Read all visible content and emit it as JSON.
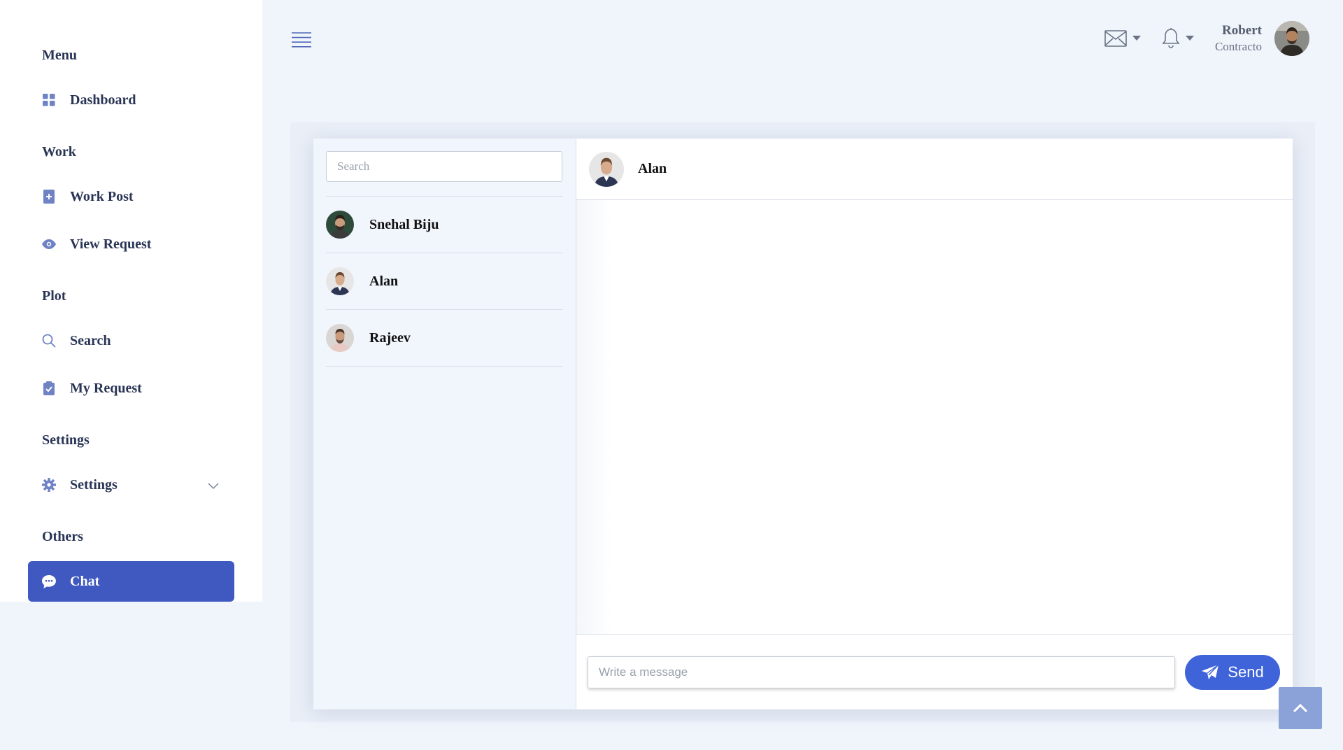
{
  "sidebar": {
    "sections": [
      {
        "heading": "Menu",
        "items": [
          {
            "label": "Dashboard",
            "icon": "dashboard-icon"
          }
        ]
      },
      {
        "heading": "Work",
        "items": [
          {
            "label": "Work Post",
            "icon": "work-post-icon"
          },
          {
            "label": "View Request",
            "icon": "eye-icon"
          }
        ]
      },
      {
        "heading": "Plot",
        "items": [
          {
            "label": "Search",
            "icon": "search-icon"
          },
          {
            "label": "My Request",
            "icon": "clipboard-icon"
          }
        ]
      },
      {
        "heading": "Settings",
        "items": [
          {
            "label": "Settings",
            "icon": "gear-icon"
          }
        ]
      },
      {
        "heading": "Others",
        "items": [
          {
            "label": "Chat",
            "icon": "chat-icon",
            "active": true
          }
        ]
      }
    ]
  },
  "topbar": {
    "user_name": "Robert",
    "user_role": "Contracto"
  },
  "chat": {
    "search_placeholder": "Search",
    "contacts": [
      {
        "name": "Snehal Biju"
      },
      {
        "name": "Alan"
      },
      {
        "name": "Rajeev"
      }
    ],
    "active_contact": "Alan",
    "message_placeholder": "Write a message",
    "send_label": "Send"
  },
  "colors": {
    "accent": "#4059c0",
    "send_button": "#3f63d9",
    "page_background": "#f0f4fb",
    "contacts_background": "#f1f5fc"
  }
}
